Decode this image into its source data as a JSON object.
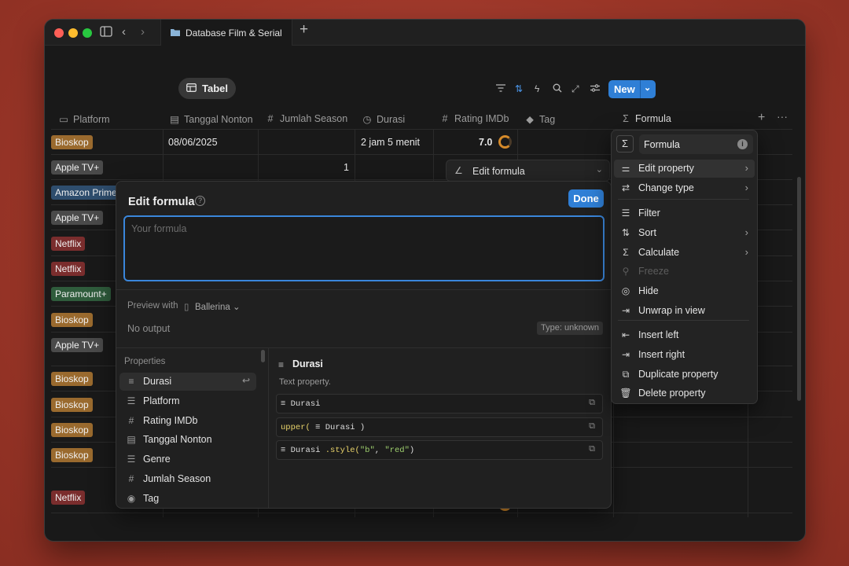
{
  "window": {
    "tab_title": "Database Film & Serial",
    "new_tab": "+"
  },
  "view": {
    "tab_label": "Tabel"
  },
  "toolbar": {
    "new_label": "New"
  },
  "columns": [
    {
      "icon": "monitor-icon",
      "label": "Platform"
    },
    {
      "icon": "calendar-icon",
      "label": "Tanggal Nonton"
    },
    {
      "icon": "hash-icon",
      "label": "Jumlah Season"
    },
    {
      "icon": "clock-icon",
      "label": "Durasi"
    },
    {
      "icon": "hash-icon",
      "label": "Rating IMDb"
    },
    {
      "icon": "tag-icon",
      "label": "Tag"
    },
    {
      "icon": "sigma-icon",
      "label": "Formula"
    }
  ],
  "rows": [
    {
      "platform": "Bioskop",
      "color": "#9a6a2e",
      "date": "08/06/2025",
      "season": "",
      "duration": "2 jam 5 menit",
      "rating": "7.0"
    },
    {
      "platform": "Apple TV+",
      "color": "#4a4a4a",
      "date": "",
      "season": "1",
      "duration": "",
      "rating": ""
    },
    {
      "platform": "Amazon Prime",
      "color": "#2e4d6d"
    },
    {
      "platform": "Apple TV+",
      "color": "#4a4a4a"
    },
    {
      "platform": "Netflix",
      "color": "#7a2d2d"
    },
    {
      "platform": "Netflix",
      "color": "#7a2d2d"
    },
    {
      "platform": "Paramount+",
      "color": "#2f5c3c"
    },
    {
      "platform": "Bioskop",
      "color": "#9a6a2e"
    },
    {
      "platform": "Apple TV+",
      "color": "#4a4a4a"
    },
    {
      "platform": "Bioskop",
      "color": "#9a6a2e"
    },
    {
      "platform": "Bioskop",
      "color": "#9a6a2e"
    },
    {
      "platform": "Bioskop",
      "color": "#9a6a2e"
    },
    {
      "platform": "Bioskop",
      "color": "#9a6a2e"
    },
    {
      "platform": "Netflix",
      "color": "#7a2d2d"
    }
  ],
  "edit_bar": {
    "label": "Edit formula"
  },
  "modal": {
    "title": "Edit formula",
    "done_label": "Done",
    "placeholder": "Your formula",
    "preview_label": "Preview with",
    "preview_page": "Ballerina",
    "output": "No output",
    "type_badge": "Type: unknown",
    "properties_header": "Properties",
    "properties": [
      {
        "icon": "text-icon",
        "label": "Durasi"
      },
      {
        "icon": "list-icon",
        "label": "Platform"
      },
      {
        "icon": "hash-icon",
        "label": "Rating IMDb"
      },
      {
        "icon": "calendar-icon",
        "label": "Tanggal Nonton"
      },
      {
        "icon": "list-icon",
        "label": "Genre"
      },
      {
        "icon": "hash-icon",
        "label": "Jumlah Season"
      },
      {
        "icon": "tag-icon",
        "label": "Tag"
      }
    ],
    "detail": {
      "title": "Durasi",
      "subtitle": "Text property.",
      "ex1_prop": "Durasi",
      "ex2_fn": "upper(",
      "ex2_prop": "Durasi",
      "ex2_close": ")",
      "ex3_prop": "Durasi",
      "ex3_method": ".style(",
      "ex3_a1": "\"b\"",
      "ex3_comma": ", ",
      "ex3_a2": "\"red\"",
      "ex3_close": ")"
    }
  },
  "property_menu": {
    "name": "Formula",
    "items": [
      {
        "icon": "sliders-icon",
        "label": "Edit property",
        "arrow": true
      },
      {
        "icon": "swap-icon",
        "label": "Change type",
        "arrow": true
      },
      {
        "icon": "filter-icon",
        "label": "Filter",
        "arrow": false
      },
      {
        "icon": "sort-icon",
        "label": "Sort",
        "arrow": true
      },
      {
        "icon": "sigma-icon",
        "label": "Calculate",
        "arrow": true
      },
      {
        "icon": "pin-icon",
        "label": "Freeze",
        "arrow": false,
        "disabled": true
      },
      {
        "icon": "eye-off-icon",
        "label": "Hide",
        "arrow": false
      },
      {
        "icon": "unwrap-icon",
        "label": "Unwrap in view",
        "arrow": false
      },
      {
        "icon": "insert-left-icon",
        "label": "Insert left",
        "arrow": false
      },
      {
        "icon": "insert-right-icon",
        "label": "Insert right",
        "arrow": false
      },
      {
        "icon": "duplicate-icon",
        "label": "Duplicate property",
        "arrow": false
      },
      {
        "icon": "trash-icon",
        "label": "Delete property",
        "arrow": false
      }
    ]
  },
  "colors": {
    "accent": "#2f7fd6",
    "background": "#191919",
    "menu": "#232323"
  }
}
